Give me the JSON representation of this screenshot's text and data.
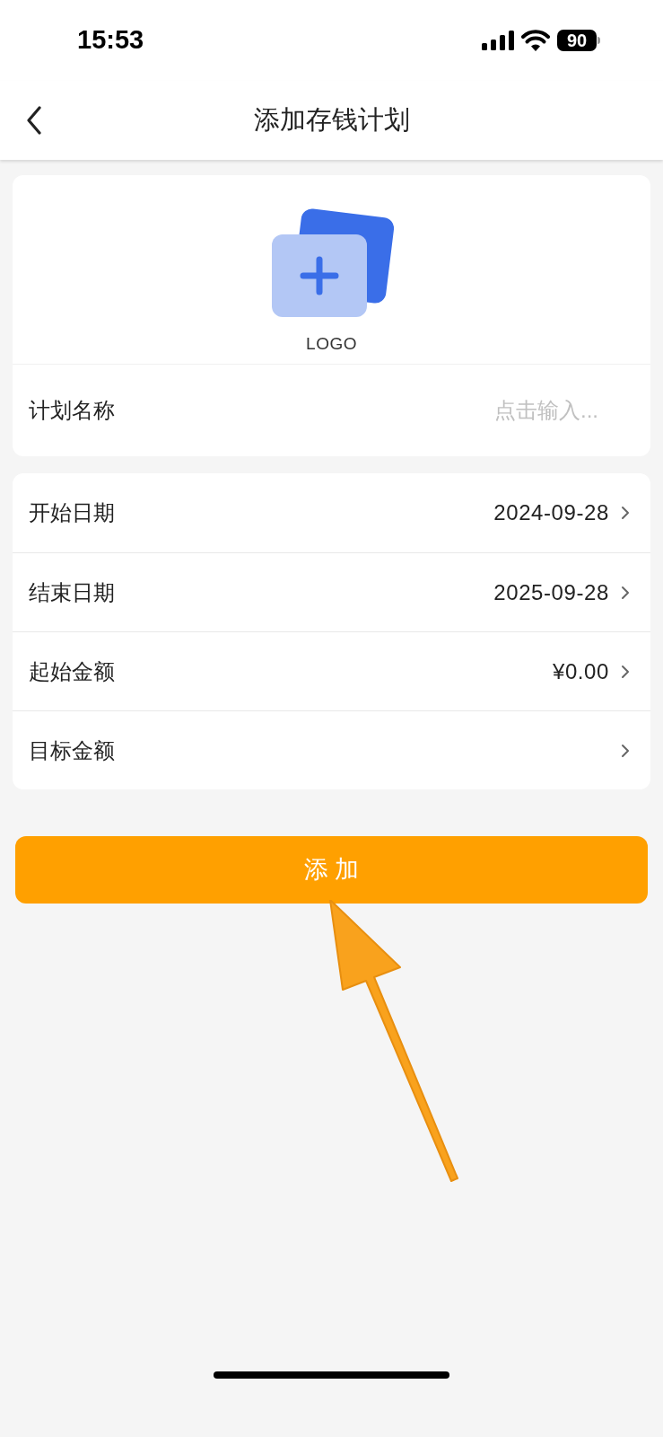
{
  "status_bar": {
    "time": "15:53",
    "battery": "90"
  },
  "nav": {
    "title": "添加存钱计划"
  },
  "logo": {
    "label": "LOGO"
  },
  "name_field": {
    "label": "计划名称",
    "placeholder": "点击输入..."
  },
  "rows": [
    {
      "label": "开始日期",
      "value": "2024-09-28"
    },
    {
      "label": "结束日期",
      "value": "2025-09-28"
    },
    {
      "label": "起始金额",
      "value": "¥0.00"
    },
    {
      "label": "目标金额"
    }
  ],
  "button": {
    "label": "添 加"
  }
}
